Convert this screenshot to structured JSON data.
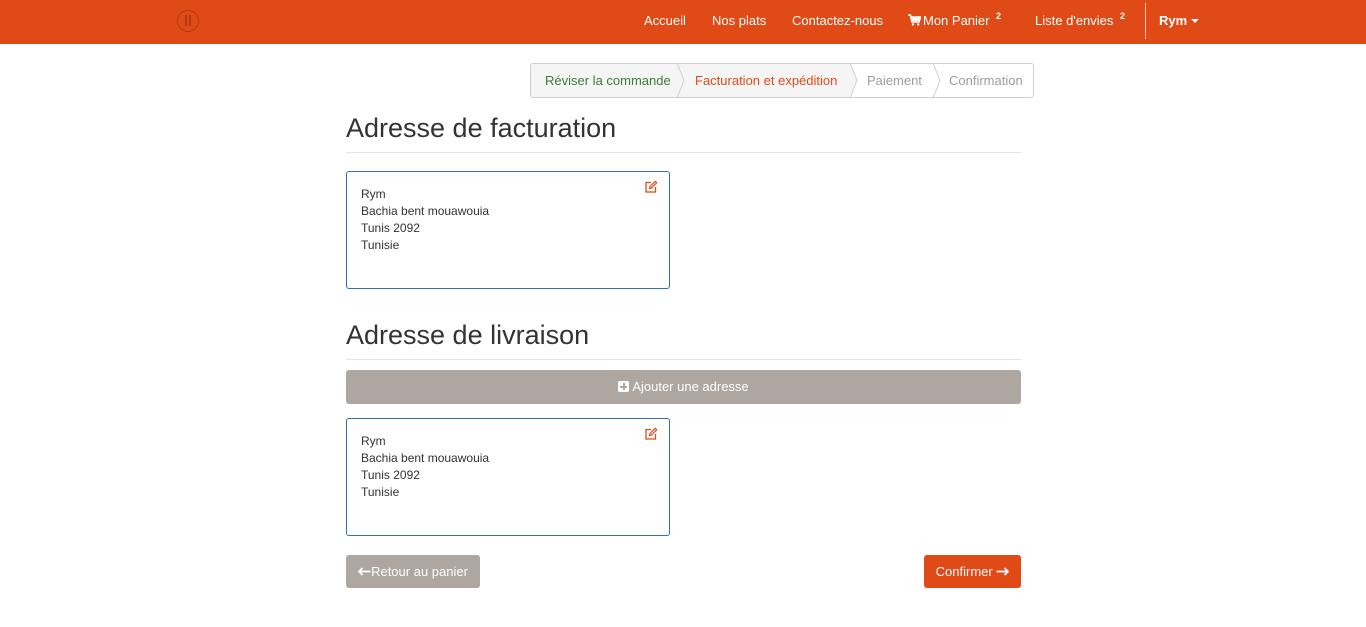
{
  "navbar": {
    "links": {
      "home": "Accueil",
      "dishes": "Nos plats",
      "contact": "Contactez-nous",
      "cart": "Mon Panier",
      "cart_count": "2",
      "wishlist": "Liste d'envies",
      "wishlist_count": "2"
    },
    "user": "Rym",
    "accent_color": "#df4a16"
  },
  "steps": [
    {
      "label": "Réviser la commande",
      "state": "done"
    },
    {
      "label": "Facturation et expédition",
      "state": "active"
    },
    {
      "label": "Paiement",
      "state": "pending"
    },
    {
      "label": "Confirmation",
      "state": "pending"
    }
  ],
  "billing": {
    "title": "Adresse de facturation",
    "address": [
      "Rym",
      "Bachia bent mouawouia",
      "Tunis 2092",
      "Tunisie"
    ]
  },
  "shipping": {
    "title": "Adresse de livraison",
    "add_button": "Ajouter une adresse",
    "address": [
      "Rym",
      "Bachia bent mouawouia",
      "Tunis 2092",
      "Tunisie"
    ]
  },
  "actions": {
    "back": "Retour au panier",
    "confirm": "Confirmer"
  },
  "icons": {
    "logo": "logo-icon",
    "cart": "shopping-cart-icon",
    "edit": "edit-icon",
    "add": "plus-square-icon",
    "back": "arrow-left-icon",
    "confirm": "arrow-right-icon"
  }
}
